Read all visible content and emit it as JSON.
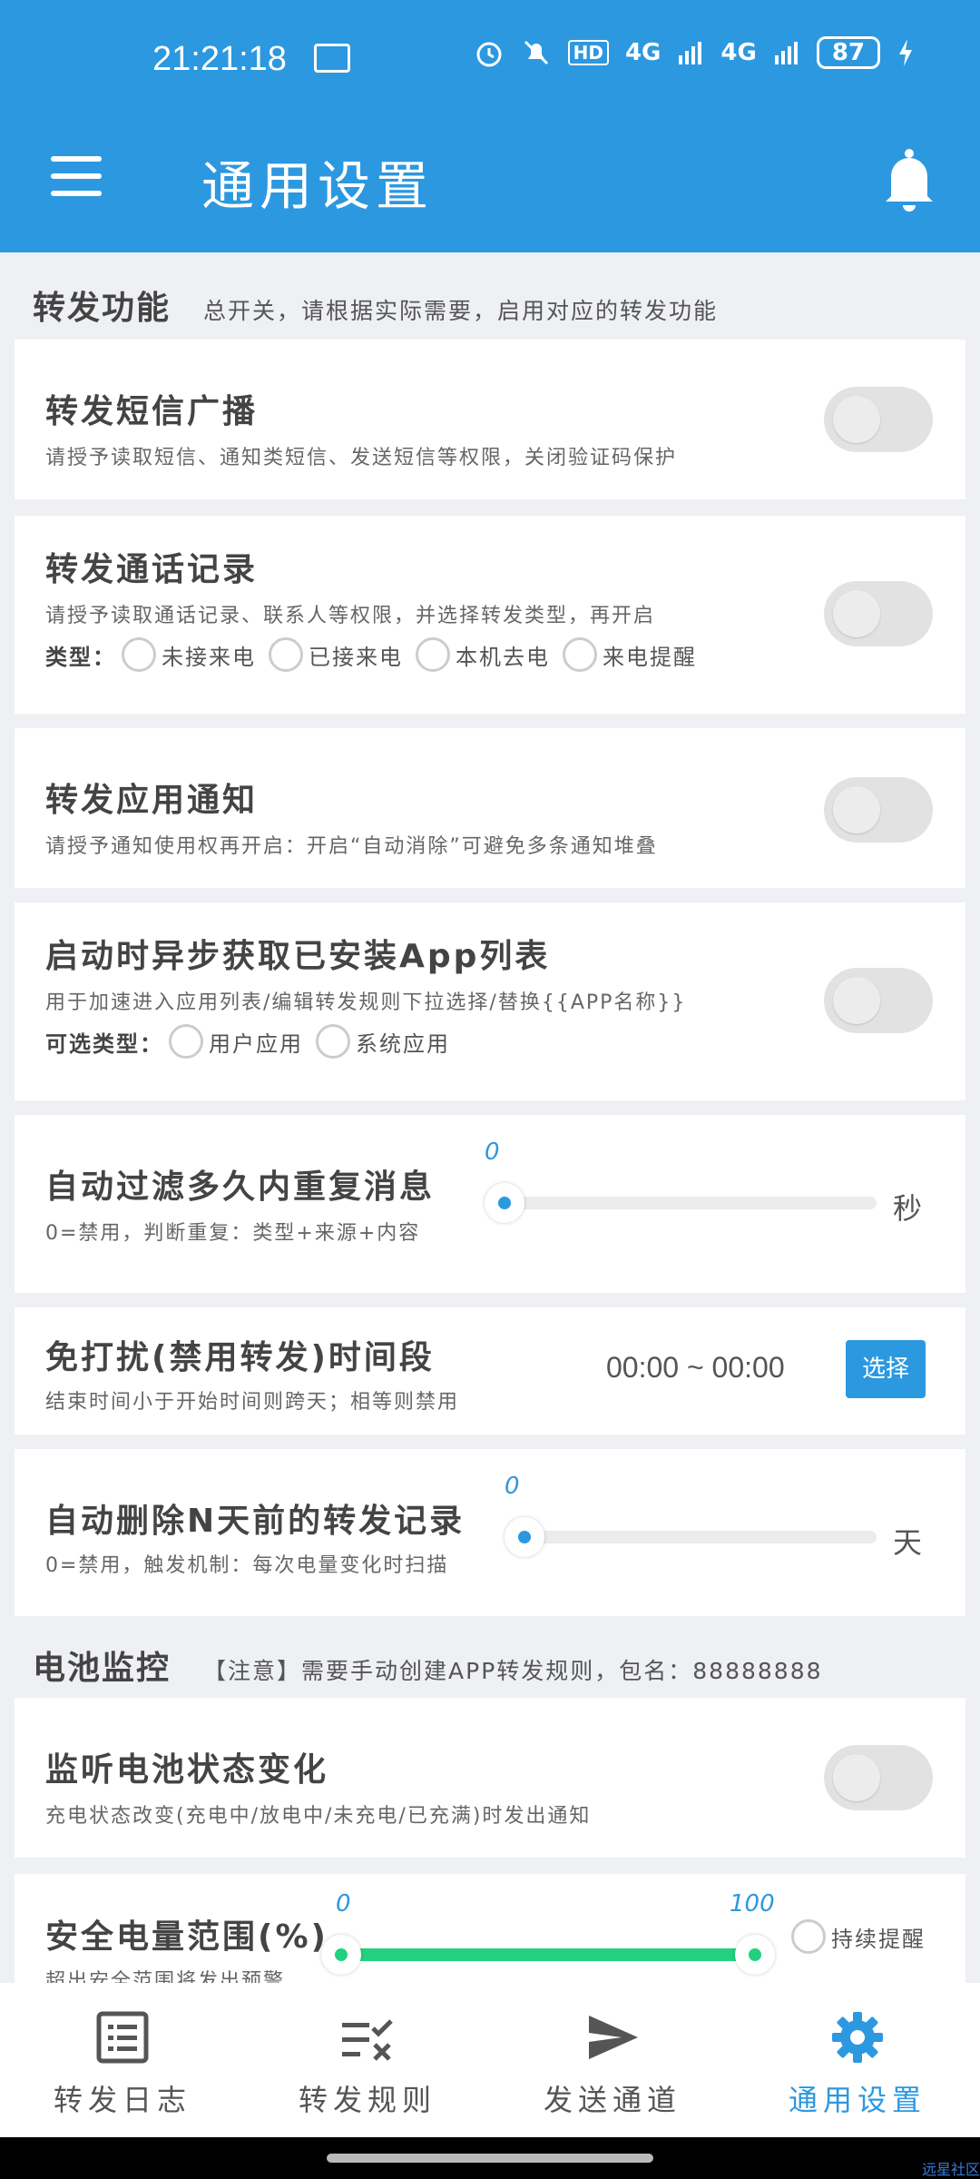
{
  "status_bar": {
    "time": "21:21:18",
    "network": "4G",
    "network2": "4G",
    "battery": "87",
    "hd": "HD"
  },
  "app_bar": {
    "title": "通用设置"
  },
  "forwarding_section": {
    "title": "转发功能",
    "desc": "总开关，请根据实际需要，启用对应的转发功能"
  },
  "sms": {
    "title": "转发短信广播",
    "desc": "请授予读取短信、通知类短信、发送短信等权限，关闭验证码保护",
    "enabled": false
  },
  "call": {
    "title": "转发通话记录",
    "desc": "请授予读取通话记录、联系人等权限，并选择转发类型，再开启",
    "type_label": "类型：",
    "options": [
      "未接来电",
      "已接来电",
      "本机去电",
      "来电提醒"
    ],
    "enabled": false
  },
  "app_notify": {
    "title": "转发应用通知",
    "desc": "请授予通知使用权再开启：开启“自动消除”可避免多条通知堆叠",
    "enabled": false
  },
  "app_list": {
    "title": "启动时异步获取已安装App列表",
    "desc": "用于加速进入应用列表/编辑转发规则下拉选择/替换{{APP名称}}",
    "type_label": "可选类型：",
    "options": [
      "用户应用",
      "系统应用"
    ],
    "enabled": false
  },
  "dup_filter": {
    "title": "自动过滤多久内重复消息",
    "desc": "0=禁用，判断重复：类型+来源+内容",
    "value": "0",
    "unit": "秒"
  },
  "dnd": {
    "title": "免打扰(禁用转发)时间段",
    "desc": "结束时间小于开始时间则跨天；相等则禁用",
    "range": "00:00 ~ 00:00",
    "button": "选择"
  },
  "auto_delete": {
    "title": "自动删除N天前的转发记录",
    "desc": "0=禁用，触发机制：每次电量变化时扫描",
    "value": "0",
    "unit": "天"
  },
  "battery_section": {
    "title": "电池监控",
    "desc": "【注意】需要手动创建APP转发规则，包名：88888888"
  },
  "battery_state": {
    "title": "监听电池状态变化",
    "desc": "充电状态改变(充电中/放电中/未充电/已充满)时发出通知",
    "enabled": false
  },
  "battery_range": {
    "title": "安全电量范围(%)",
    "desc": "超出安全范围将发出预警",
    "min": "0",
    "max": "100",
    "keep_label": "持续提醒"
  },
  "bottom_nav": [
    {
      "label": "转发日志",
      "icon": "log-list-icon"
    },
    {
      "label": "转发规则",
      "icon": "rules-check-icon"
    },
    {
      "label": "发送通道",
      "icon": "send-icon"
    },
    {
      "label": "通用设置",
      "icon": "gear-icon"
    }
  ],
  "watermark": "远星社区",
  "colors": {
    "primary": "#2c98e0",
    "slider_green": "#21d17f",
    "background": "#eef0f3"
  }
}
